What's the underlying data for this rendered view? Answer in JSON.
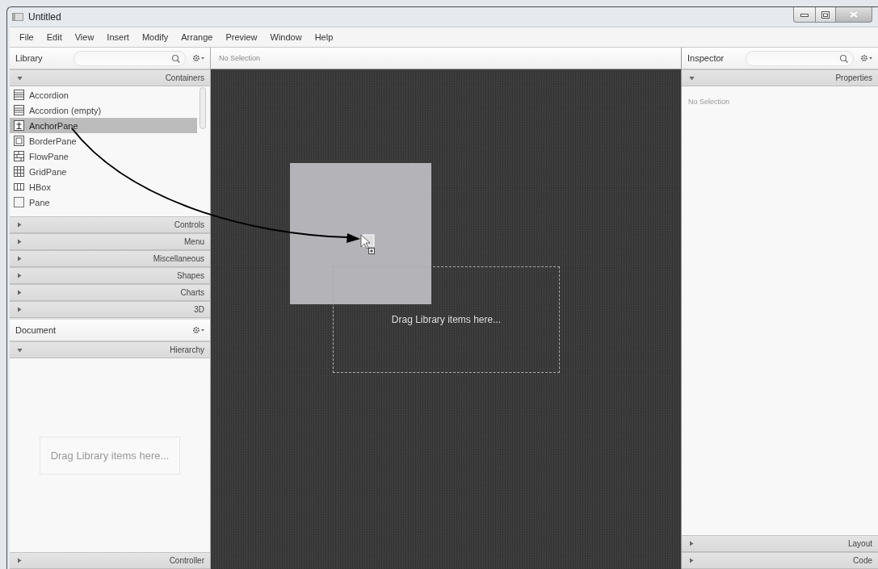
{
  "window": {
    "title": "Untitled"
  },
  "menu": [
    {
      "label": "File"
    },
    {
      "label": "Edit"
    },
    {
      "label": "View"
    },
    {
      "label": "Insert"
    },
    {
      "label": "Modify"
    },
    {
      "label": "Arrange"
    },
    {
      "label": "Preview"
    },
    {
      "label": "Window"
    },
    {
      "label": "Help"
    }
  ],
  "library": {
    "title": "Library",
    "sections": [
      {
        "label": "Containers",
        "expanded": true,
        "items": [
          {
            "label": "Accordion",
            "selected": false
          },
          {
            "label": "Accordion  (empty)",
            "selected": false
          },
          {
            "label": "AnchorPane",
            "selected": true
          },
          {
            "label": "BorderPane",
            "selected": false
          },
          {
            "label": "FlowPane",
            "selected": false
          },
          {
            "label": "GridPane",
            "selected": false
          },
          {
            "label": "HBox",
            "selected": false
          },
          {
            "label": "Pane",
            "selected": false
          }
        ]
      },
      {
        "label": "Controls",
        "expanded": false
      },
      {
        "label": "Menu",
        "expanded": false
      },
      {
        "label": "Miscellaneous",
        "expanded": false
      },
      {
        "label": "Shapes",
        "expanded": false
      },
      {
        "label": "Charts",
        "expanded": false
      },
      {
        "label": "3D",
        "expanded": false
      }
    ]
  },
  "document": {
    "title": "Document",
    "sections": [
      {
        "label": "Hierarchy",
        "expanded": true
      },
      {
        "label": "Controller",
        "expanded": false
      }
    ],
    "hint": "Drag Library items here..."
  },
  "content": {
    "breadcrumb": "No Selection",
    "hint": "Drag Library items here..."
  },
  "inspector": {
    "title": "Inspector",
    "sections": [
      {
        "label": "Properties",
        "expanded": true
      },
      {
        "label": "Layout",
        "expanded": false
      },
      {
        "label": "Code",
        "expanded": false
      }
    ],
    "message": "No Selection"
  }
}
